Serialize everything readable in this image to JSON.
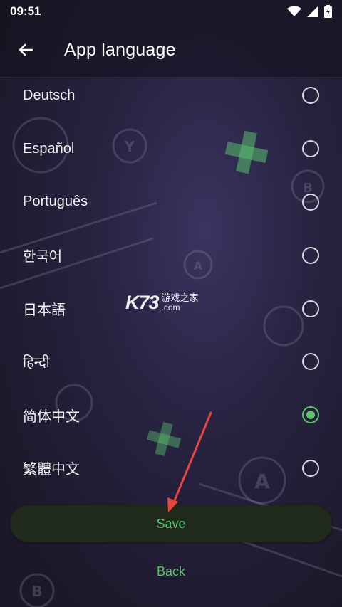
{
  "status_bar": {
    "time": "09:51"
  },
  "app_bar": {
    "title": "App language"
  },
  "languages": [
    {
      "label": "Deutsch",
      "selected": false
    },
    {
      "label": "Español",
      "selected": false
    },
    {
      "label": "Português",
      "selected": false
    },
    {
      "label": "한국어",
      "selected": false
    },
    {
      "label": "日本語",
      "selected": false
    },
    {
      "label": "हिन्दी",
      "selected": false
    },
    {
      "label": "简体中文",
      "selected": true
    },
    {
      "label": "繁體中文",
      "selected": false
    }
  ],
  "actions": {
    "save_label": "Save",
    "back_label": "Back"
  },
  "watermark": {
    "logo": "K73",
    "site_cn": "游戏之家",
    "domain": ".com"
  },
  "colors": {
    "accent": "#5cc36c",
    "annotation_arrow": "#e8453c",
    "save_button_bg": "#1f2a1d"
  },
  "icons": {
    "back": "arrow-left-icon",
    "wifi": "wifi-icon",
    "signal": "signal-icon",
    "battery": "battery-icon"
  }
}
